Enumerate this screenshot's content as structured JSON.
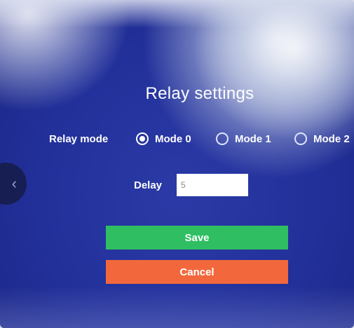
{
  "dialog": {
    "title": "Relay settings",
    "relay_mode_label": "Relay mode",
    "modes": [
      {
        "label": "Mode 0",
        "checked": true
      },
      {
        "label": "Mode 1",
        "checked": false
      },
      {
        "label": "Mode 2",
        "checked": false
      }
    ],
    "delay_label": "Delay",
    "delay_value": "5",
    "save_label": "Save",
    "cancel_label": "Cancel"
  },
  "nav": {
    "back_glyph": "‹",
    "back_icon": "chevron-left-icon"
  },
  "colors": {
    "background": "#2633a0",
    "save": "#2fbf62",
    "cancel": "#f2683c"
  }
}
